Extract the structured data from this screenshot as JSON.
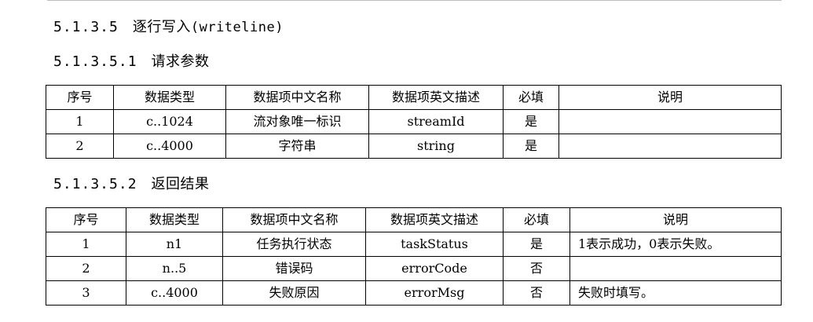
{
  "section": {
    "number": "5.1.3.5",
    "title": "逐行写入",
    "title_en": "(writeline)"
  },
  "request": {
    "number": "5.1.3.5.1",
    "title": "请求参数",
    "headers": [
      "序号",
      "数据类型",
      "数据项中文名称",
      "数据项英文描述",
      "必填",
      "说明"
    ],
    "rows": [
      [
        "1",
        "c..1024",
        "流对象唯一标识",
        "streamId",
        "是",
        ""
      ],
      [
        "2",
        "c..4000",
        "字符串",
        "string",
        "是",
        ""
      ]
    ]
  },
  "response": {
    "number": "5.1.3.5.2",
    "title": "返回结果",
    "headers": [
      "序号",
      "数据类型",
      "数据项中文名称",
      "数据项英文描述",
      "必填",
      "说明"
    ],
    "rows": [
      [
        "1",
        "n1",
        "任务执行状态",
        "taskStatus",
        "是",
        "1表示成功，0表示失败。"
      ],
      [
        "2",
        "n..5",
        "错误码",
        "errorCode",
        "否",
        ""
      ],
      [
        "3",
        "c..4000",
        "失败原因",
        "errorMsg",
        "否",
        "失败时填写。"
      ]
    ]
  }
}
